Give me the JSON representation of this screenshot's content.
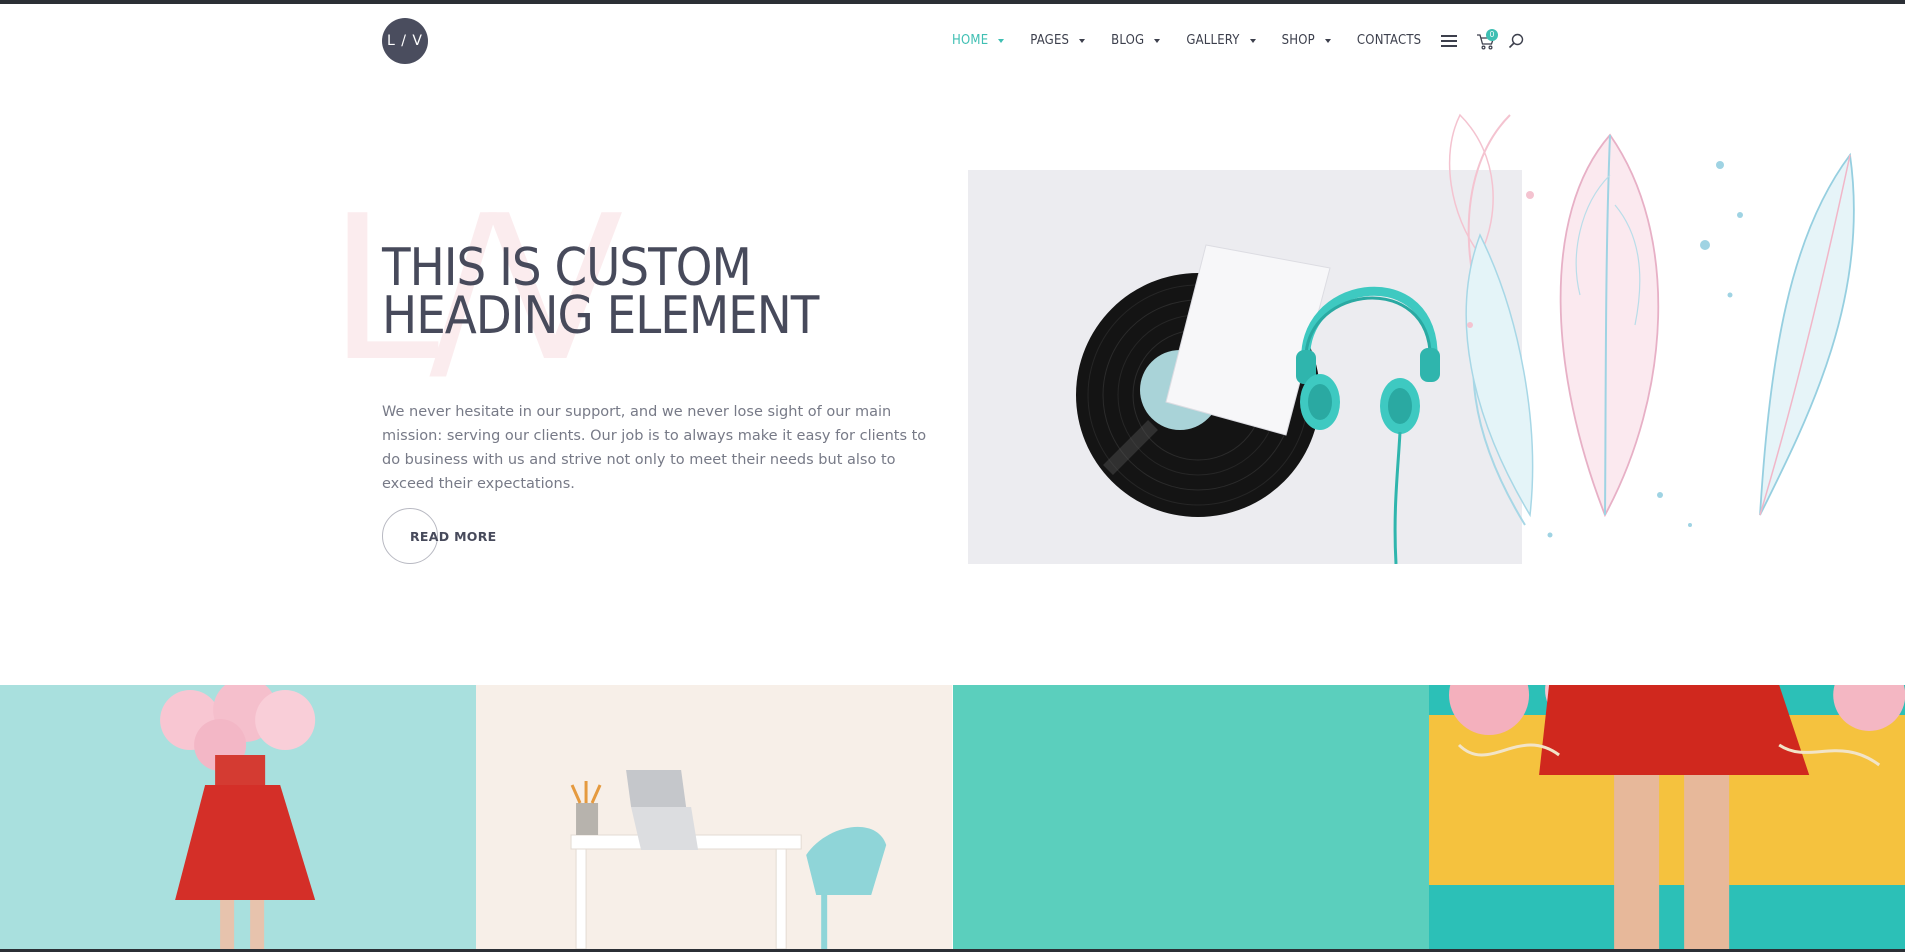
{
  "header": {
    "logo_text": "L / V",
    "nav": [
      {
        "label": "HOME",
        "active": true,
        "has_dropdown": true
      },
      {
        "label": "PAGES",
        "active": false,
        "has_dropdown": true
      },
      {
        "label": "BLOG",
        "active": false,
        "has_dropdown": true
      },
      {
        "label": "GALLERY",
        "active": false,
        "has_dropdown": true
      },
      {
        "label": "SHOP",
        "active": false,
        "has_dropdown": true
      },
      {
        "label": "CONTACTS",
        "active": false,
        "has_dropdown": false
      }
    ],
    "cart_count": "0",
    "icons": [
      "menu-icon",
      "cart-icon",
      "search-icon"
    ]
  },
  "hero": {
    "watermark": "L/V",
    "title": "THIS IS CUSTOM HEADING ELEMENT",
    "text": "We never hesitate in our support, and we never lose sight of our main mission: serving our clients. Our job is to always make it easy for clients to do business with us and strive not only to meet their needs but also to exceed their expectations.",
    "button_label": "READ MORE"
  },
  "colors": {
    "accent": "#3fbfb3",
    "dark": "#474a5b",
    "watermark": "#fbecee",
    "tile_teal": "#5bcfbd"
  }
}
